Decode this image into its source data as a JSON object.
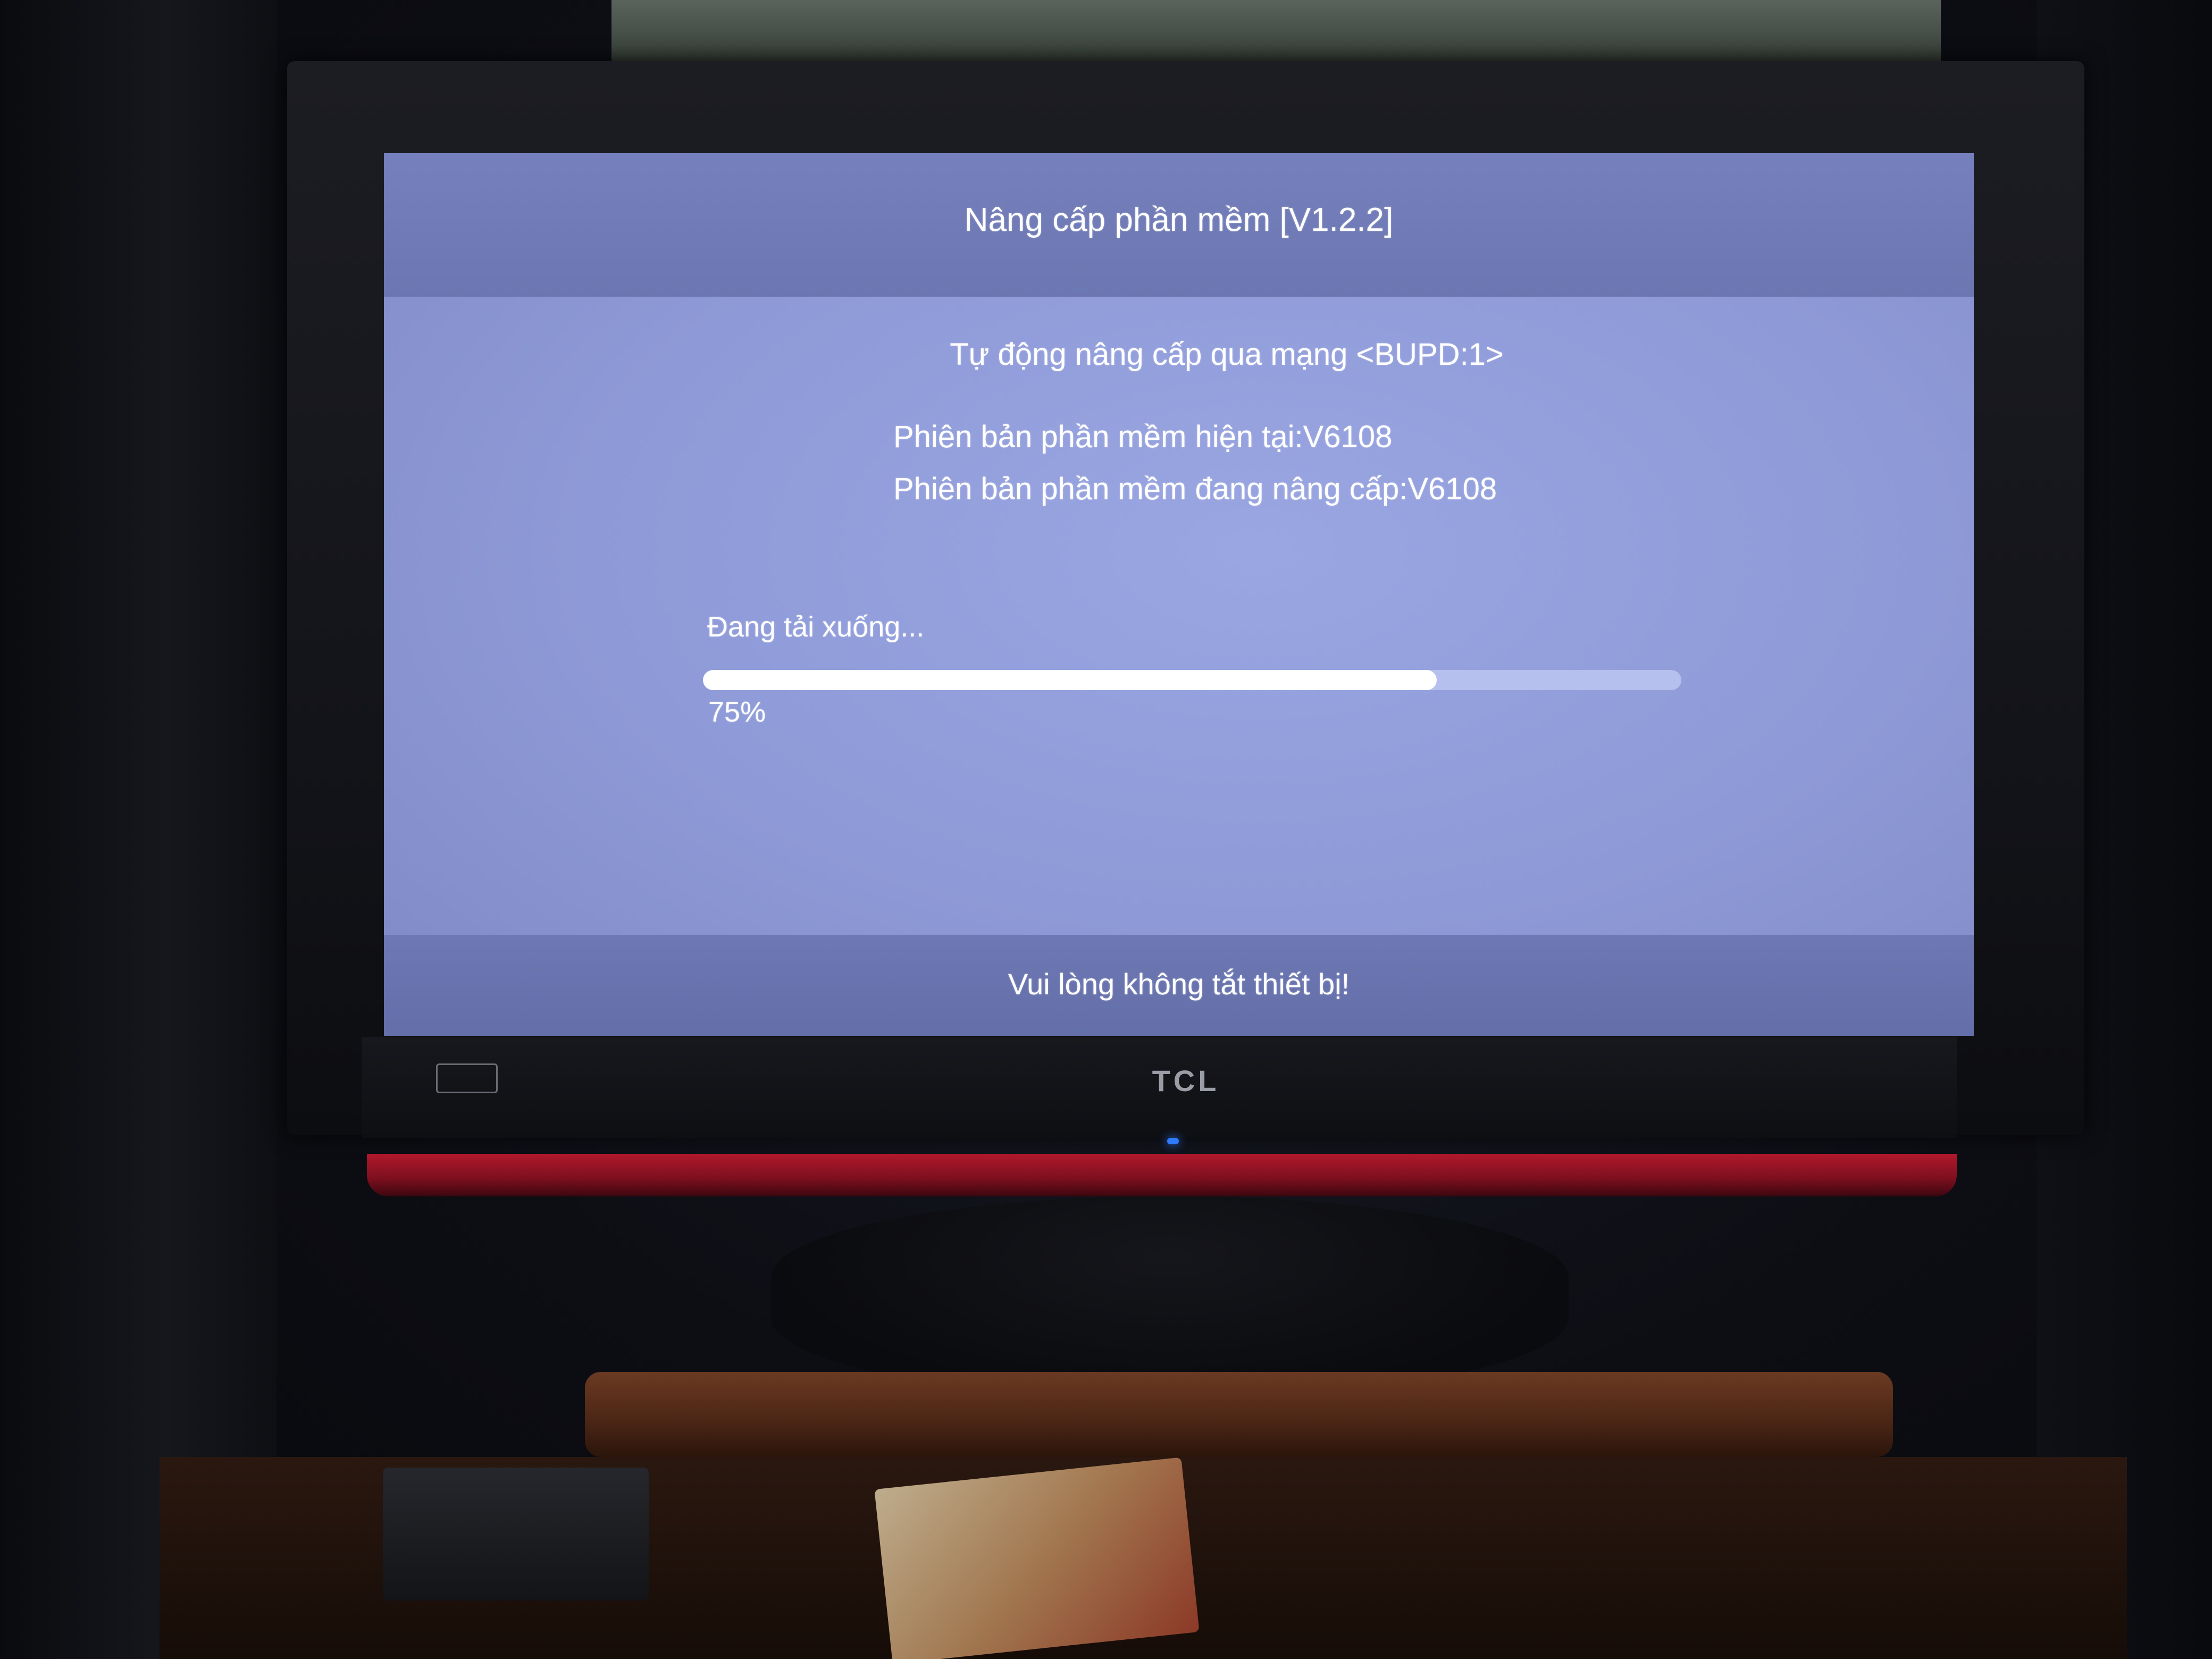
{
  "dialog": {
    "title": "Nâng cấp phần mềm [V1.2.2]",
    "subtitle": "Tự động nâng cấp qua mạng <BUPD:1>",
    "current_version": "Phiên bản phần mềm hiện tại:V6108",
    "upgrade_version": "Phiên bản phần mềm đang nâng cấp:V6108",
    "status": "Đang tải xuống...",
    "progress_percent": 75,
    "progress_label": "75%",
    "footer_warning": "Vui lòng không tắt thiết bị!"
  },
  "tv": {
    "brand": "TCL"
  },
  "colors": {
    "screen_background": "#8e9ad7",
    "header_band": "#7580bc",
    "progress_fill": "#ffffff",
    "progress_track": "#b6c0ee",
    "tv_red_band": "#b2182c",
    "power_led": "#2f7bff"
  }
}
